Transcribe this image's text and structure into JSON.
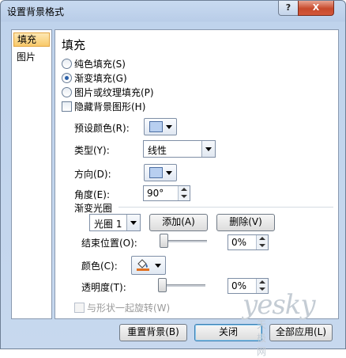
{
  "window": {
    "title": "设置背景格式",
    "help_label": "?",
    "close_label": "X"
  },
  "nav": {
    "items": [
      {
        "label": "填充"
      },
      {
        "label": "图片"
      }
    ]
  },
  "content": {
    "heading": "填充",
    "fill_options": [
      {
        "label": "纯色填充(S)",
        "checked": false
      },
      {
        "label": "渐变填充(G)",
        "checked": true
      },
      {
        "label": "图片或纹理填充(P)",
        "checked": false
      }
    ],
    "hide_bg_label": "隐藏背景图形(H)",
    "preset_color_label": "预设颜色(R):",
    "type_label": "类型(Y):",
    "type_value": "线性",
    "direction_label": "方向(D):",
    "angle_label": "角度(E):",
    "angle_value": "90°",
    "gradient_stops_label": "渐变光圈",
    "stop_value": "光圈 1",
    "add_label": "添加(A)",
    "delete_label": "删除(V)",
    "end_position_label": "结束位置(O):",
    "end_position_value": "0%",
    "color_label": "颜色(C):",
    "transparency_label": "透明度(T):",
    "transparency_value": "0%",
    "rotate_with_shape_label": "与形状一起旋转(W)"
  },
  "footer": {
    "reset_label": "重置背景(B)",
    "close_label": "关闭",
    "apply_all_label": "全部应用(L)"
  },
  "watermark": {
    "brand": "yesky",
    "sub": "天极网"
  },
  "colors": {
    "accent": "#f8c96a",
    "bucket_fill": "#e07020",
    "swatch": "#b8cff0"
  }
}
